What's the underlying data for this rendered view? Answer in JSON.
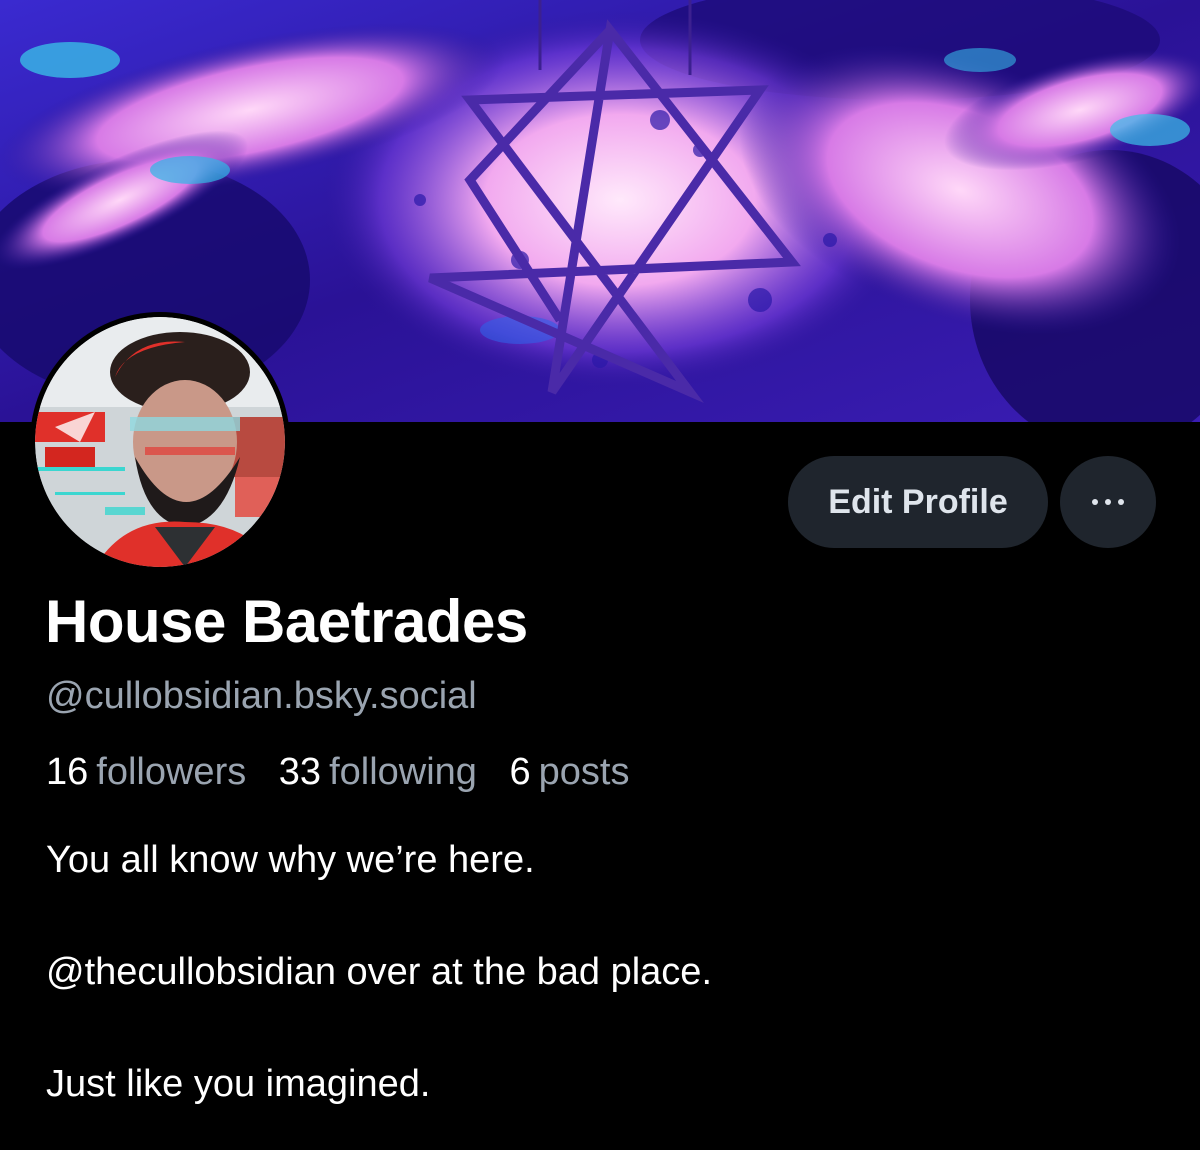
{
  "profile": {
    "display_name": "House Baetrades",
    "handle": "@cullobsidian.bsky.social",
    "stats": {
      "followers_count": "16",
      "followers_label": "followers",
      "following_count": "33",
      "following_label": "following",
      "posts_count": "6",
      "posts_label": "posts"
    },
    "bio": {
      "line1": "You all know why we’re here.",
      "line2": "@thecullobsidian over at the bad place.",
      "line3": "Just like you imagined."
    }
  },
  "actions": {
    "edit_profile_label": "Edit Profile",
    "more_icon": "ellipsis-icon"
  },
  "colors": {
    "background": "#000000",
    "button_bg": "#1f252d",
    "secondary_text": "#9aa4b0",
    "banner_base": "#2a1496",
    "banner_glow": "#f3b8f0"
  }
}
